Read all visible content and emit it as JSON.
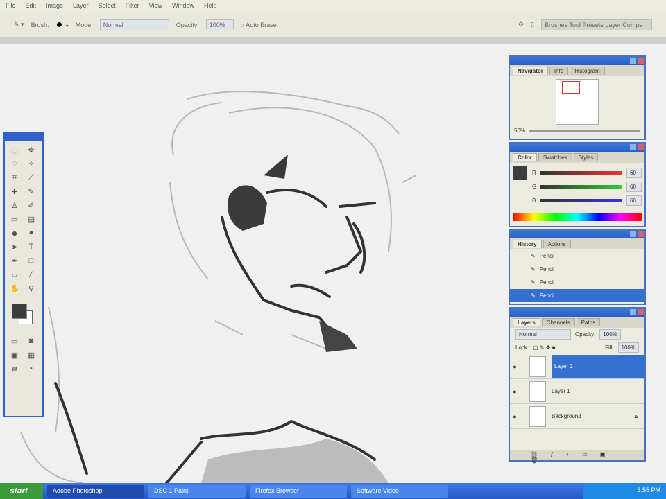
{
  "menu": [
    "File",
    "Edit",
    "Image",
    "Layer",
    "Select",
    "Filter",
    "View",
    "Window",
    "Help"
  ],
  "options": {
    "brush_label": "Brush:",
    "mode_label": "Mode:",
    "mode_value": "Normal",
    "opacity_label": "Opacity:",
    "opacity_value": "100%",
    "auto_erase": "Auto Erase",
    "workspace": "Brushes  Tool Presets  Layer Comps"
  },
  "navigator": {
    "tabs": [
      "Navigator",
      "Info",
      "Histogram"
    ],
    "zoom": "50%"
  },
  "color": {
    "tabs": [
      "Color",
      "Swatches",
      "Styles"
    ],
    "channels": [
      {
        "label": "R",
        "value": "60"
      },
      {
        "label": "G",
        "value": "60"
      },
      {
        "label": "B",
        "value": "60"
      }
    ]
  },
  "history": {
    "tabs": [
      "History",
      "Actions"
    ],
    "items": [
      "Pencil",
      "Pencil",
      "Pencil",
      "Pencil"
    ]
  },
  "layers": {
    "tabs": [
      "Layers",
      "Channels",
      "Paths"
    ],
    "blend": "Normal",
    "opacity_label": "Opacity:",
    "opacity": "100%",
    "lock_label": "Lock:",
    "fill_label": "Fill:",
    "fill": "100%",
    "items": [
      {
        "name": "Layer 2",
        "selected": true
      },
      {
        "name": "Layer 1",
        "selected": false
      },
      {
        "name": "Background",
        "selected": false
      }
    ]
  },
  "taskbar": {
    "start": "start",
    "tasks": [
      "Adobe Photoshop",
      "DSC 1  Paint",
      "Firefox  Browser",
      "Software  Video"
    ],
    "clock": "3:55 PM"
  }
}
